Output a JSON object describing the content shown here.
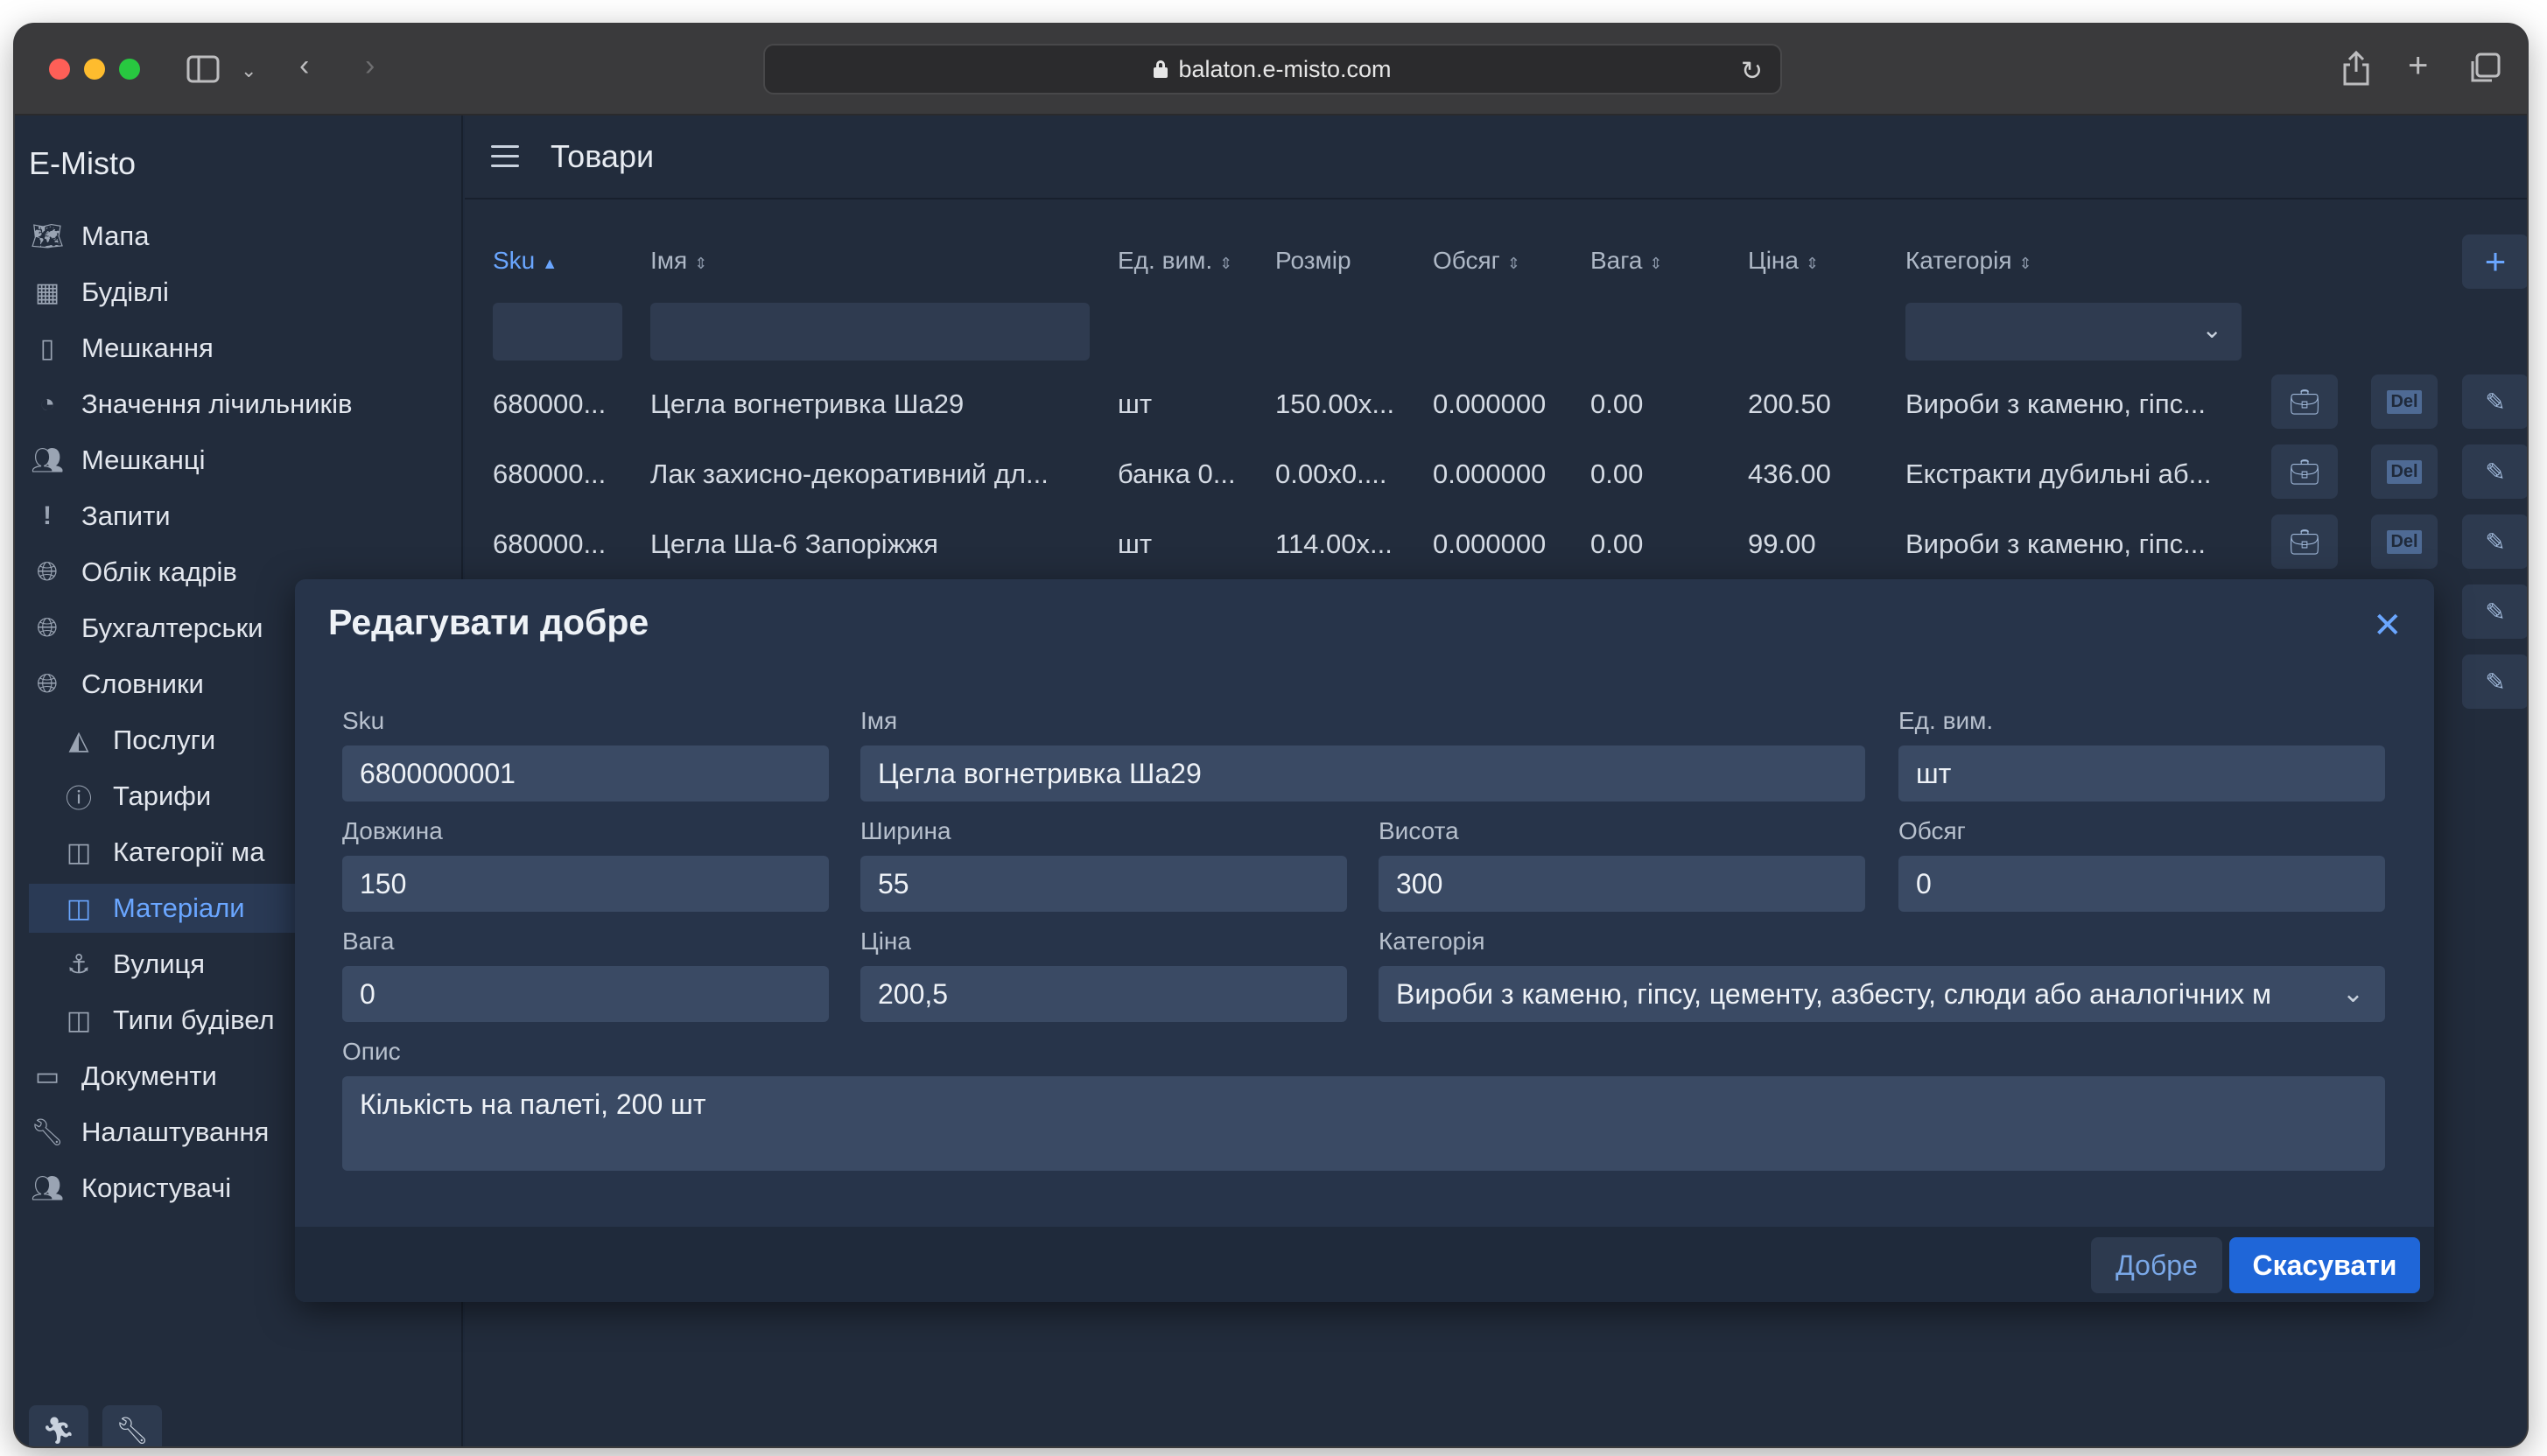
{
  "browser": {
    "url": "balaton.e-misto.com"
  },
  "sidebar": {
    "brand": "E-Misto",
    "items": [
      {
        "label": "Мапа",
        "icon": "map-icon"
      },
      {
        "label": "Будівлі",
        "icon": "building-icon"
      },
      {
        "label": "Мешкання",
        "icon": "door-icon"
      },
      {
        "label": "Значення лічильників",
        "icon": "gauge-icon"
      },
      {
        "label": "Мешканці",
        "icon": "people-icon"
      },
      {
        "label": "Запити",
        "icon": "exclamation-icon"
      },
      {
        "label": "Облік кадрів",
        "icon": "globe-icon"
      },
      {
        "label": "Бухгалтерськи",
        "icon": "globe-icon"
      },
      {
        "label": "Словники",
        "icon": "globe-icon"
      },
      {
        "label": "Послуги",
        "icon": "service-icon"
      },
      {
        "label": "Тарифи",
        "icon": "question-circle-icon"
      },
      {
        "label": "Категорії ма",
        "icon": "columns-icon"
      },
      {
        "label": "Матеріали",
        "icon": "columns-icon"
      },
      {
        "label": "Вулиця",
        "icon": "anchor-icon"
      },
      {
        "label": "Типи будівел",
        "icon": "columns-icon"
      },
      {
        "label": "Документи",
        "icon": "document-icon"
      },
      {
        "label": "Налаштування",
        "icon": "wrench-icon"
      },
      {
        "label": "Користувачі",
        "icon": "people-icon"
      }
    ],
    "active_item": "Матеріали"
  },
  "main": {
    "title": "Товари",
    "columns": [
      "Sku",
      "Імя",
      "Ед. вим.",
      "Розмір",
      "Обсяг",
      "Вага",
      "Ціна",
      "Категорія"
    ],
    "rows": [
      [
        "680000...",
        "Цегла вогнетривка Ша29",
        "шт",
        "150.00x...",
        "0.000000",
        "0.00",
        "200.50",
        "Вироби з каменю, гіпс..."
      ],
      [
        "680000...",
        "Лак захисно-декоративний дл...",
        "банка 0...",
        "0.00x0....",
        "0.000000",
        "0.00",
        "436.00",
        "Екстракти дубильні аб..."
      ],
      [
        "680000...",
        "Цегла Ша-6 Запоріжжя",
        "шт",
        "114.00x...",
        "0.000000",
        "0.00",
        "99.00",
        "Вироби з каменю, гіпс..."
      ]
    ],
    "del_label": "Del"
  },
  "dialog": {
    "title": "Редагувати добре",
    "fields": {
      "sku": {
        "label": "Sku",
        "value": "6800000001"
      },
      "name": {
        "label": "Імя",
        "value": "Цегла вогнетривка Ша29"
      },
      "unit": {
        "label": "Ед. вим.",
        "value": "шт"
      },
      "length": {
        "label": "Довжина",
        "value": "150"
      },
      "width": {
        "label": "Ширина",
        "value": "55"
      },
      "height": {
        "label": "Висота",
        "value": "300"
      },
      "volume": {
        "label": "Обсяг",
        "value": "0"
      },
      "weight": {
        "label": "Вага",
        "value": "0"
      },
      "price": {
        "label": "Ціна",
        "value": "200,5"
      },
      "category": {
        "label": "Категорія",
        "value": "Вироби з каменю, гіпсу, цементу, азбесту, слюди або аналогічних м"
      },
      "description": {
        "label": "Опис",
        "value": "Кількість на палеті, 200 шт"
      }
    },
    "ok_label": "Добре",
    "cancel_label": "Скасувати"
  },
  "colors": {
    "accent": "#6aa6ff",
    "primary_button": "#1f66d8",
    "background": "#222c3c"
  }
}
